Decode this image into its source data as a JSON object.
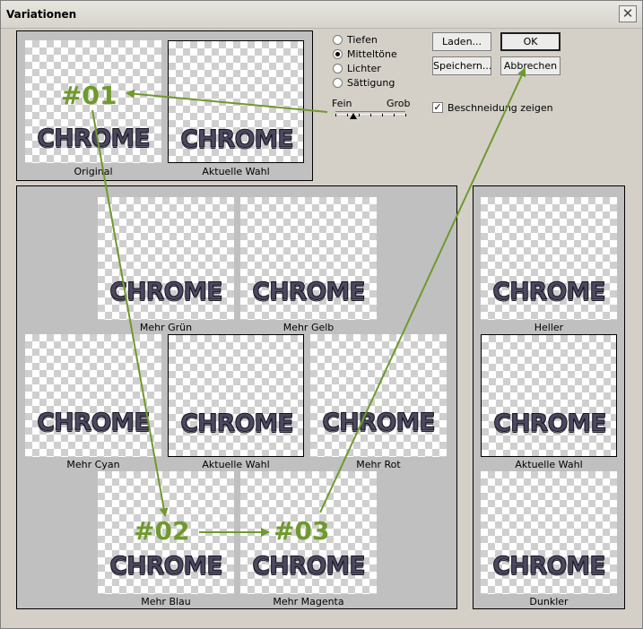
{
  "window": {
    "title": "Variationen",
    "close_glyph": "✕"
  },
  "thumb_text": "CHROME",
  "preview": {
    "original": "Original",
    "current": "Aktuelle Wahl"
  },
  "tones": {
    "options": [
      "Tiefen",
      "Mitteltöne",
      "Lichter",
      "Sättigung"
    ],
    "selected": "Mitteltöne"
  },
  "slider": {
    "fine_label": "Fein",
    "coarse_label": "Grob",
    "level": 0.25
  },
  "buttons": {
    "load": "Laden...",
    "ok": "OK",
    "save": "Speichern...",
    "cancel": "Abbrechen"
  },
  "clipping": {
    "label": "Beschneidung zeigen",
    "checked": true
  },
  "color_grid": {
    "more_green": "Mehr Grün",
    "more_yellow": "Mehr Gelb",
    "more_cyan": "Mehr Cyan",
    "current": "Aktuelle Wahl",
    "more_red": "Mehr Rot",
    "more_blue": "Mehr Blau",
    "more_magenta": "Mehr Magenta"
  },
  "brightness": {
    "lighter": "Heller",
    "current": "Aktuelle Wahl",
    "darker": "Dunkler"
  },
  "annotations": {
    "step1": "#01",
    "step2": "#02",
    "step3": "#03",
    "color": "#6f9a2d"
  }
}
